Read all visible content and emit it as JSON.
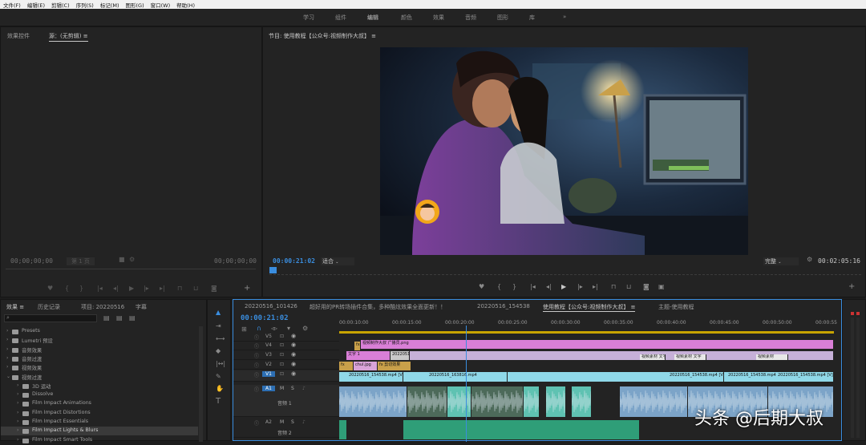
{
  "menu": [
    "文件(F)",
    "编辑(E)",
    "剪辑(C)",
    "序列(S)",
    "标记(M)",
    "图形(G)",
    "窗口(W)",
    "帮助(H)"
  ],
  "workspaces": [
    "学习",
    "组件",
    "编辑",
    "颜色",
    "效果",
    "音频",
    "图形",
    "库",
    "»"
  ],
  "source": {
    "tab1": "效果控件",
    "tab2": "源：(无剪辑)",
    "tc_left": "00;00;00;00",
    "page": "第 1 页",
    "tc_right": "00;00;00;00"
  },
  "program": {
    "title": "节目: 使用教程【公众号:视频制作大叔】",
    "tc": "00:00:21:02",
    "fit": "适合",
    "quality": "完整",
    "duration": "00:02:05:16"
  },
  "effects": {
    "tabs": [
      "效果",
      "历史记录",
      "项目: 20220516",
      "字幕"
    ],
    "items": [
      {
        "name": "Presets",
        "level": 0
      },
      {
        "name": "Lumetri 预设",
        "level": 0
      },
      {
        "name": "音频效果",
        "level": 0
      },
      {
        "name": "音频过渡",
        "level": 0
      },
      {
        "name": "视频效果",
        "level": 0
      },
      {
        "name": "视频过渡",
        "level": 0,
        "open": true
      },
      {
        "name": "3D 运动",
        "level": 1
      },
      {
        "name": "Dissolve",
        "level": 1
      },
      {
        "name": "Film Impact Animations",
        "level": 1
      },
      {
        "name": "Film Impact Distortions",
        "level": 1
      },
      {
        "name": "Film Impact Essentials",
        "level": 1
      },
      {
        "name": "Film Impact Lights & Blurs",
        "level": 1,
        "selected": true
      },
      {
        "name": "Film Impact Smart Tools",
        "level": 1
      }
    ]
  },
  "timeline": {
    "tabs": [
      "20220516_101426",
      "超好用的PR转场插件合集，多种酷炫效果全面更新！！",
      "20220516_154538",
      "使用教程【公众号:视频制作大叔】",
      "主题-使用教程"
    ],
    "tc": "00:00:21:02",
    "ruler": [
      "00:00:10:00",
      "00:00:15:00",
      "00:00:20:00",
      "00:00:25:00",
      "00:00:30:00",
      "00:00:35:00",
      "00:00:40:00",
      "00:00:45:00",
      "00:00:50:00",
      "00:00:55"
    ],
    "tracks": [
      "V5",
      "V4",
      "V3",
      "V2",
      "V1",
      "A1",
      "A2"
    ],
    "track_labels": {
      "a1": "音频 1",
      "a2": "音频 2"
    },
    "clips": {
      "v4a": "fx",
      "v4b": "视频制作大叔 广播员.png",
      "v3": "文字 1",
      "v3b": "20220516_154538.mp4",
      "v2b": "chul.jpg",
      "v2c": "fx 剪切效果",
      "v1a": "20220516_154538.mp4 [V]",
      "v1b": "20220516_163816.mp4",
      "v1c": "20220516_154538.mp4 [V]",
      "v1d": "20220516_154538.mp4 [V]",
      "v1e": "20220516_154538.mp4 [V]",
      "v2d": "视频素材 文字",
      "v2e": "视频素材"
    }
  },
  "watermark": "头条 @后期大叔",
  "colors": {
    "accent": "#3a8dde",
    "timeline_pink": "#d97fd7",
    "timeline_cyan": "#8fd8e8",
    "audio_teal": "#5fc2b2",
    "audio_green": "#2f9e78"
  }
}
